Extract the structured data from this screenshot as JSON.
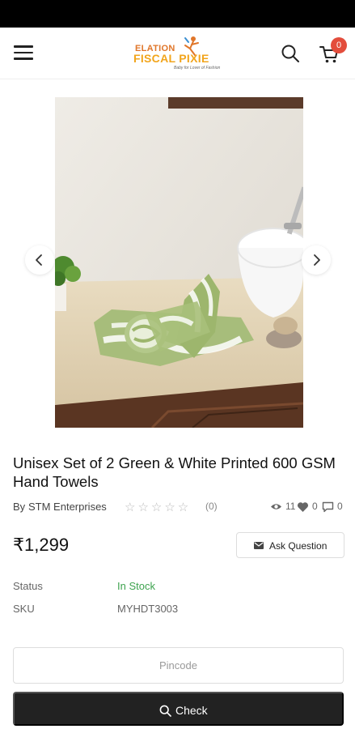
{
  "header": {
    "logo": {
      "line1": "ELATION",
      "line2": "FISCAL PIXIE",
      "tagline": "Baby for Lover of Fashion"
    },
    "cart_count": "0",
    "icons": [
      "menu-icon",
      "search-icon",
      "cart-icon"
    ]
  },
  "gallery": {
    "image_alt": "Unisex Set of 2 Green & White Printed 600 GSM Hand Towels",
    "icons": [
      "chevron-left-icon",
      "chevron-right-icon"
    ]
  },
  "product": {
    "title": "Unisex Set of 2 Green & White Printed 600 GSM Hand Towels",
    "by_label": "By",
    "vendor": "STM Enterprises",
    "rating_stars": "☆☆☆☆☆",
    "review_count": "(0)",
    "views": "11",
    "likes": "0",
    "comments": "0",
    "price": "₹1,299",
    "ask_question_label": "Ask Question",
    "status_label": "Status",
    "status_value": "In Stock",
    "sku_label": "SKU",
    "sku_value": "MYHDT3003"
  },
  "pincode": {
    "placeholder": "Pincode",
    "value": "",
    "check_label": "Check"
  },
  "colors": {
    "accent_dark": "#222222",
    "in_stock": "#3ea34f",
    "badge": "#e34d3c",
    "logo_orange": "#e0762a",
    "logo_yellow": "#f2a51c"
  }
}
